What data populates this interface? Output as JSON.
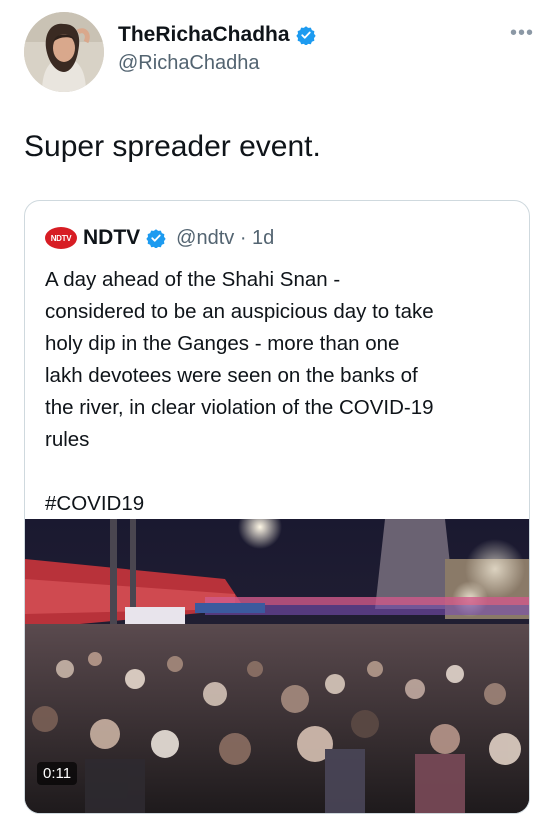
{
  "tweet": {
    "display_name": "TheRichaChadha",
    "handle": "@RichaChadha",
    "text": "Super spreader event.",
    "more_icon": "ellipsis-icon"
  },
  "quote": {
    "logo_text": "NDTV",
    "display_name": "NDTV",
    "handle_time": "@ndtv · 1d",
    "body": "A day ahead of the Shahi Snan -\nconsidered to be an auspicious day to take\nholy dip in the Ganges - more than one\nlakh devotees were seen on the banks of\nthe river, in clear violation of the COVID-19\nrules",
    "hashtag": "#COVID19",
    "video_time": "0:11"
  },
  "colors": {
    "verified": "#1d9bf0",
    "ndtv_red": "#d71d24",
    "secondary_text": "#536471"
  }
}
